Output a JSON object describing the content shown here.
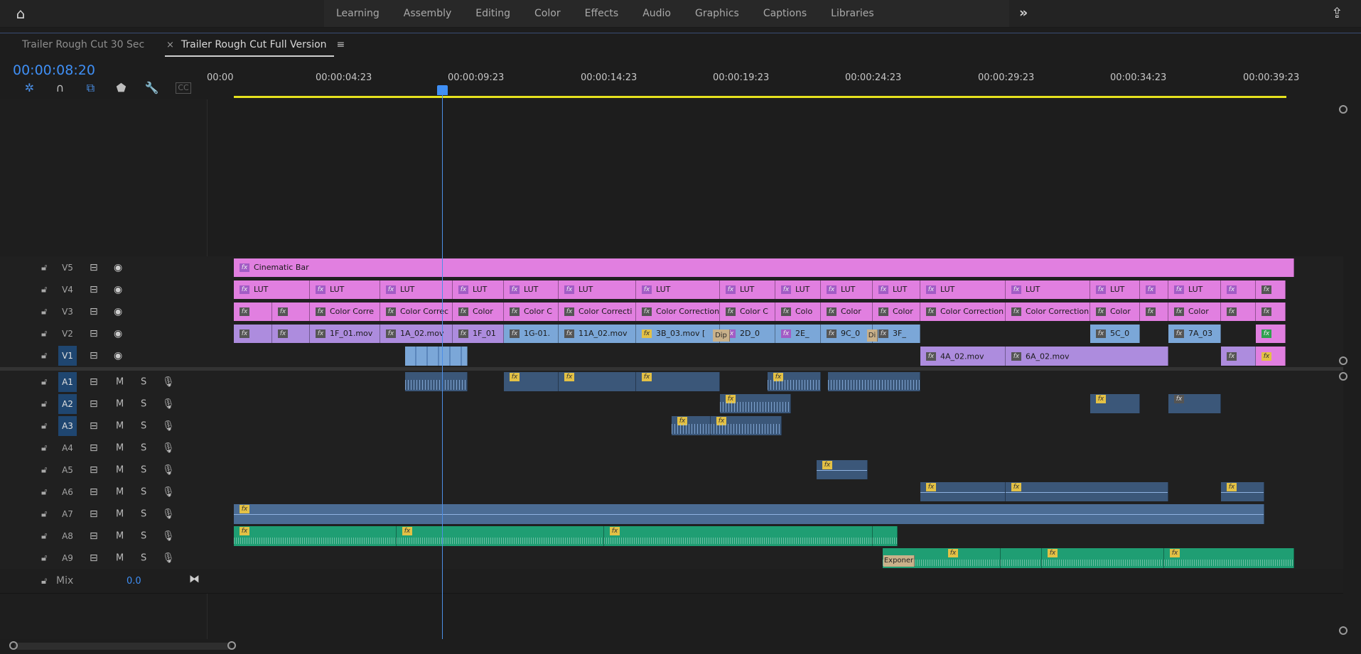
{
  "app": {
    "home_icon": "home-icon",
    "share_icon": "share-icon",
    "overflow_icon": "chevrons-right-icon"
  },
  "workspaces": [
    "Learning",
    "Assembly",
    "Editing",
    "Color",
    "Effects",
    "Audio",
    "Graphics",
    "Captions",
    "Libraries"
  ],
  "tabs": {
    "inactive": "Trailer Rough Cut 30 Sec",
    "active": "Trailer Rough Cut Full Version",
    "close": "×",
    "menu": "≡"
  },
  "timeline": {
    "timecode": "00:00:08:20",
    "ruler": [
      "00:00",
      "00:00:04:23",
      "00:00:09:23",
      "00:00:14:23",
      "00:00:19:23",
      "00:00:24:23",
      "00:00:29:23",
      "00:00:34:23",
      "00:00:39:23"
    ],
    "tools": [
      "snap-icon",
      "linked-selection-icon",
      "add-marker-icon",
      "marker-icon",
      "wrench-icon",
      "captions-icon"
    ]
  },
  "video_tracks": [
    {
      "name": "V5",
      "clips": [
        {
          "label": "Cinematic Bar"
        }
      ]
    },
    {
      "name": "V4",
      "clips": [
        {
          "label": "LUT"
        },
        {
          "label": "LUT"
        },
        {
          "label": "LUT"
        },
        {
          "label": "LUT"
        },
        {
          "label": "LUT"
        },
        {
          "label": "LUT"
        },
        {
          "label": "LUT"
        },
        {
          "label": "LUT"
        },
        {
          "label": "LUT"
        },
        {
          "label": "LUT"
        },
        {
          "label": "LUT"
        },
        {
          "label": "LUT"
        },
        {
          "label": "LUT"
        },
        {
          "label": "LUT"
        },
        {
          "label": ""
        },
        {
          "label": "LUT"
        },
        {
          "label": ""
        },
        {
          "label": ""
        }
      ]
    },
    {
      "name": "V3",
      "clips": [
        {
          "label": ""
        },
        {
          "label": ""
        },
        {
          "label": "Color Corre"
        },
        {
          "label": "Color Correc"
        },
        {
          "label": "Color"
        },
        {
          "label": "Color C"
        },
        {
          "label": "Color Correcti"
        },
        {
          "label": "Color Correction"
        },
        {
          "label": "Color C"
        },
        {
          "label": "Colo"
        },
        {
          "label": "Color"
        },
        {
          "label": "Color"
        },
        {
          "label": "Color Correction"
        },
        {
          "label": "Color Correction"
        },
        {
          "label": "Color"
        },
        {
          "label": ""
        },
        {
          "label": "Color"
        },
        {
          "label": ""
        },
        {
          "label": ""
        }
      ]
    },
    {
      "name": "V2",
      "clips": [
        {
          "label": ""
        },
        {
          "label": ""
        },
        {
          "label": "1F_01.mov"
        },
        {
          "label": "1A_02.mov"
        },
        {
          "label": "1F_01"
        },
        {
          "label": "1G-01."
        },
        {
          "label": "11A_02.mov"
        },
        {
          "label": "3B_03.mov ["
        },
        {
          "label": "2D_0"
        },
        {
          "label": "2E_"
        },
        {
          "label": "9C_0"
        },
        {
          "label": "3F_"
        },
        {
          "label": "5C_0"
        },
        {
          "label": "7A_03"
        },
        {
          "label": ""
        }
      ],
      "transitions": [
        "Dip",
        "Di"
      ]
    },
    {
      "name": "V1",
      "clips": [
        {
          "label": ""
        },
        {
          "label": "4A_02.mov"
        },
        {
          "label": "6A_02.mov"
        },
        {
          "label": ""
        },
        {
          "label": ""
        }
      ]
    }
  ],
  "audio_tracks": [
    {
      "name": "A1",
      "m": "M",
      "s": "S"
    },
    {
      "name": "A2",
      "m": "M",
      "s": "S"
    },
    {
      "name": "A3",
      "m": "M",
      "s": "S"
    },
    {
      "name": "A4",
      "m": "M",
      "s": "S"
    },
    {
      "name": "A5",
      "m": "M",
      "s": "S"
    },
    {
      "name": "A6",
      "m": "M",
      "s": "S"
    },
    {
      "name": "A7",
      "m": "M",
      "s": "S"
    },
    {
      "name": "A8",
      "m": "M",
      "s": "S"
    },
    {
      "name": "A9",
      "m": "M",
      "s": "S"
    }
  ],
  "a9_transition": "Exponer",
  "mix": {
    "label": "Mix",
    "value": "0.0"
  },
  "colors": {
    "accent": "#3f8ff5",
    "pink": "#e17fe0",
    "lavender": "#ad8cde",
    "blue": "#7ba7d8",
    "green": "#1f9e73",
    "work_area": "#e6e21e"
  }
}
